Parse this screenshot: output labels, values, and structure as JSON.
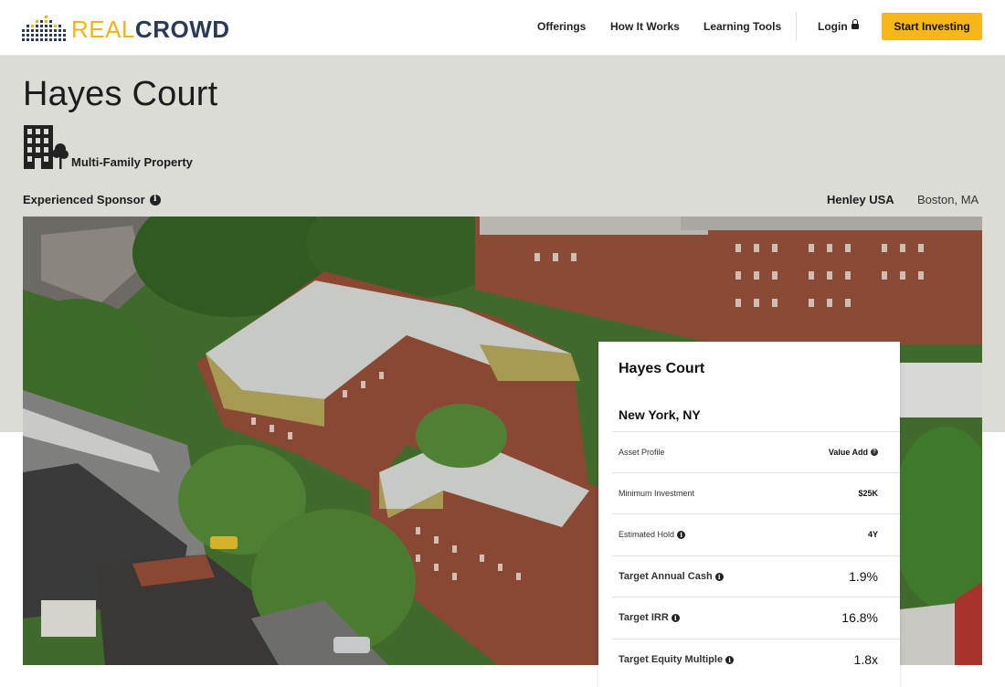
{
  "header": {
    "logo_real": "REAL",
    "logo_crowd": "CROWD",
    "nav": [
      {
        "label": "Offerings"
      },
      {
        "label": "How It Works"
      },
      {
        "label": "Learning Tools"
      }
    ],
    "login_label": "Login",
    "cta_label": "Start Investing"
  },
  "property": {
    "title": "Hayes Court",
    "type": "Multi-Family Property",
    "sponsor_badge": "Experienced Sponsor",
    "sponsor_name": "Henley USA",
    "sponsor_location": "Boston, MA"
  },
  "card": {
    "title": "Hayes Court",
    "location": "New York, NY",
    "rows": [
      {
        "label": "Asset Profile",
        "value": "Value Add"
      },
      {
        "label": "Minimum Investment",
        "value": "$25K"
      },
      {
        "label": "Estimated Hold",
        "value": "4Y"
      },
      {
        "label": "Target Annual Cash",
        "value": "1.9%"
      },
      {
        "label": "Target IRR",
        "value": "16.8%"
      },
      {
        "label": "Target Equity Multiple",
        "value": "1.8x"
      }
    ]
  },
  "colors": {
    "brand_yellow": "#f9b617",
    "brand_navy": "#2b3a55",
    "band_bg": "#dcdcd6"
  },
  "icons": {
    "info": "info-circle-icon",
    "question": "question-circle-icon",
    "lock": "lock-icon",
    "property_type": "building-tree-icon"
  }
}
